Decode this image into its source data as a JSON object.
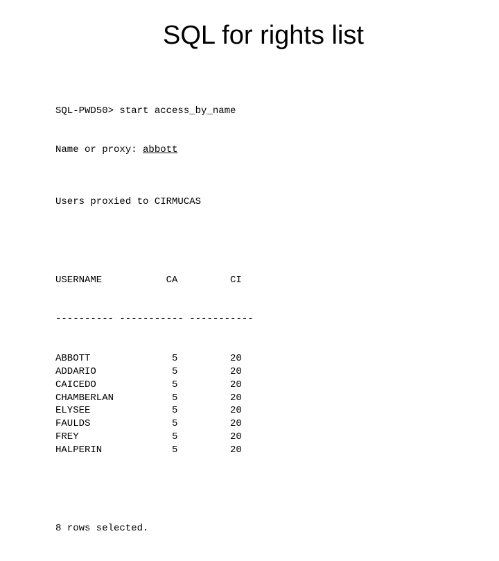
{
  "title": "SQL for rights list",
  "prompt": "SQL-PWD50> ",
  "command": "start access_by_name",
  "name_prompt": "Name or proxy: ",
  "name_input": "abbott",
  "header_text": "Users proxied to CIRMUCAS",
  "columns": {
    "username": "USERNAME",
    "ca": "CA",
    "ci": "CI"
  },
  "dividers": {
    "col1": "----------",
    "col2": "-----------",
    "col3": "-----------"
  },
  "rows": [
    {
      "username": "ABBOTT",
      "ca": "5",
      "ci": "20"
    },
    {
      "username": "ADDARIO",
      "ca": "5",
      "ci": "20"
    },
    {
      "username": "CAICEDO",
      "ca": "5",
      "ci": "20"
    },
    {
      "username": "CHAMBERLAN",
      "ca": "5",
      "ci": "20"
    },
    {
      "username": "ELYSEE",
      "ca": "5",
      "ci": "20"
    },
    {
      "username": "FAULDS",
      "ca": "5",
      "ci": "20"
    },
    {
      "username": "FREY",
      "ca": "5",
      "ci": "20"
    },
    {
      "username": "HALPERIN",
      "ca": "5",
      "ci": "20"
    }
  ],
  "summary": "8 rows selected."
}
